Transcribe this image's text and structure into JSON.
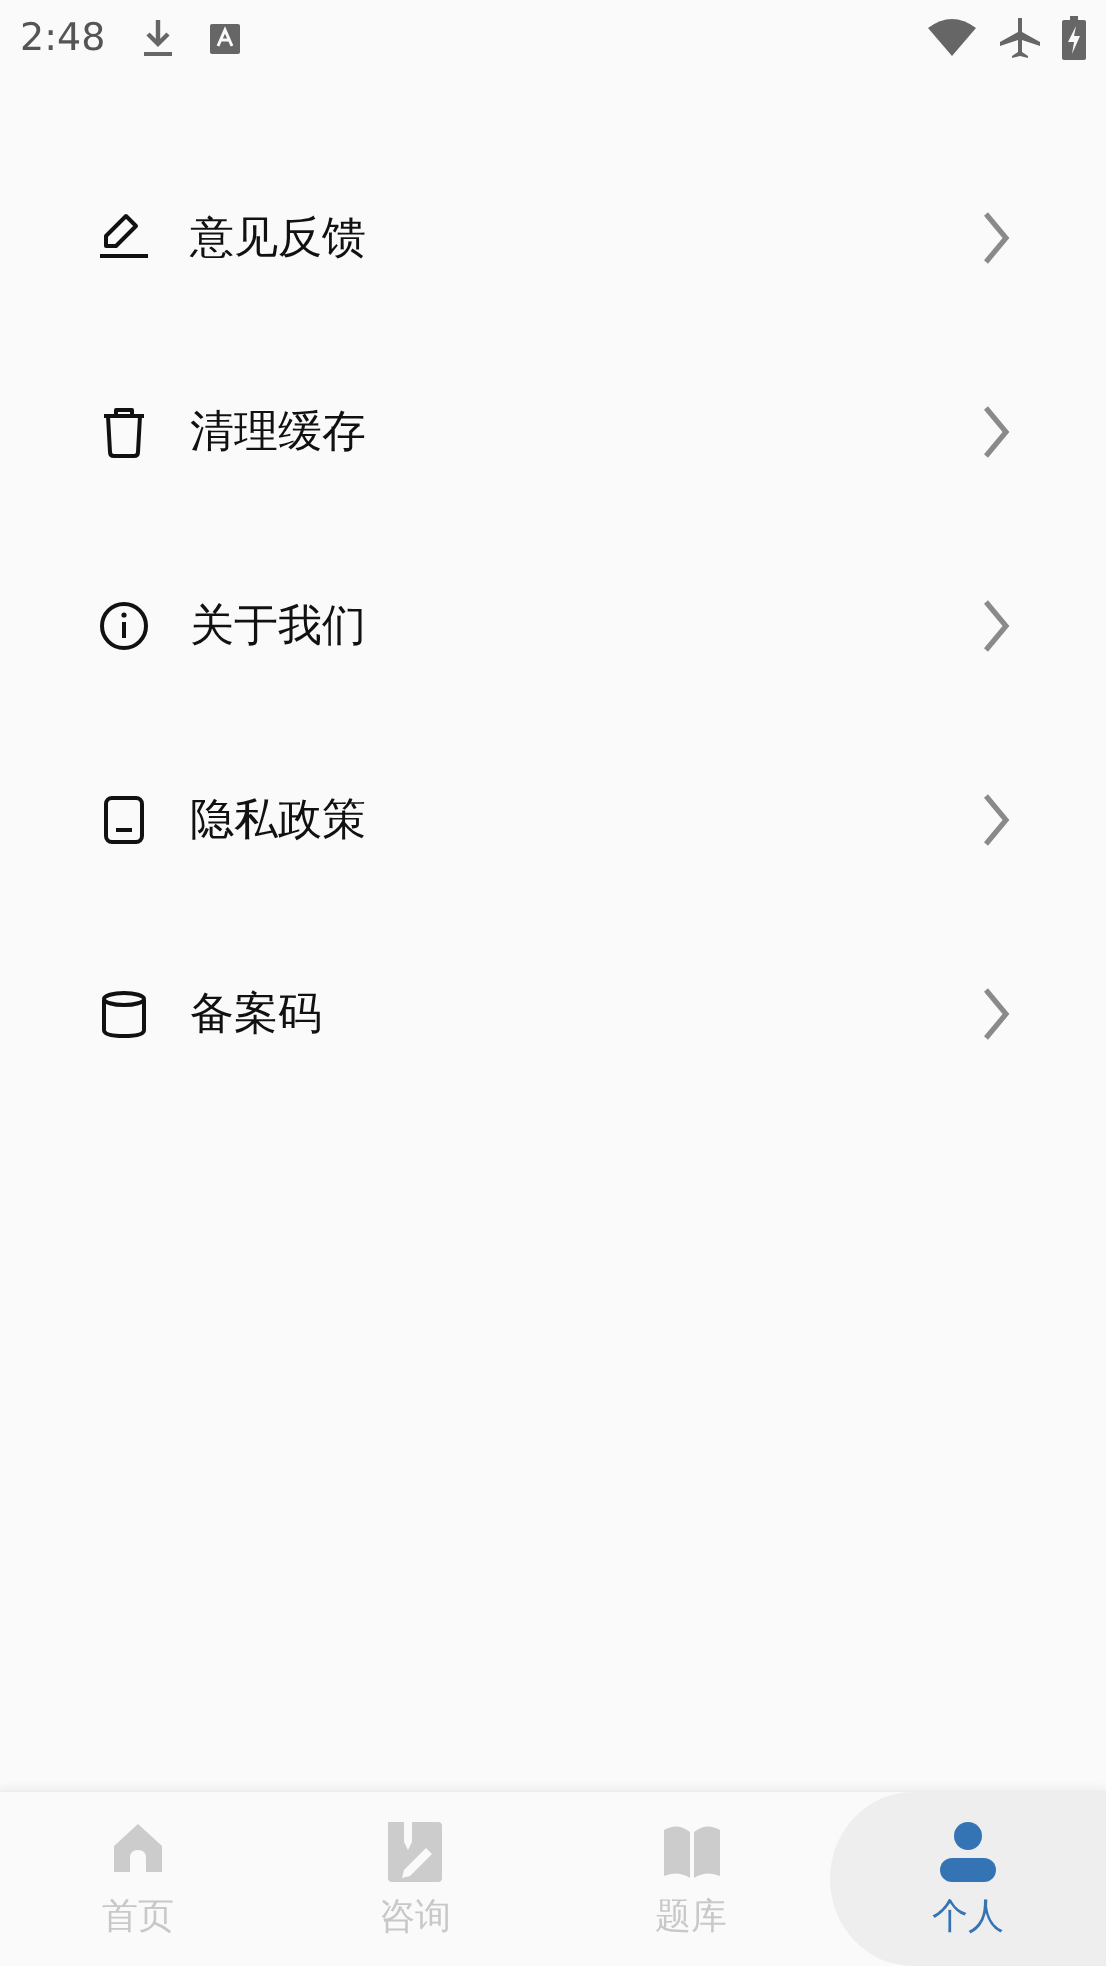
{
  "status_bar": {
    "time": "2:48"
  },
  "menu": [
    {
      "kind": "feedback",
      "label": "意见反馈"
    },
    {
      "kind": "trash",
      "label": "清理缓存"
    },
    {
      "kind": "info",
      "label": "关于我们"
    },
    {
      "kind": "privacy",
      "label": "隐私政策"
    },
    {
      "kind": "record",
      "label": "备案码"
    }
  ],
  "tabs": [
    {
      "kind": "home",
      "label": "首页",
      "selected": false
    },
    {
      "kind": "consult",
      "label": "咨询",
      "selected": false
    },
    {
      "kind": "book",
      "label": "题库",
      "selected": false
    },
    {
      "kind": "person",
      "label": "个人",
      "selected": true
    }
  ]
}
